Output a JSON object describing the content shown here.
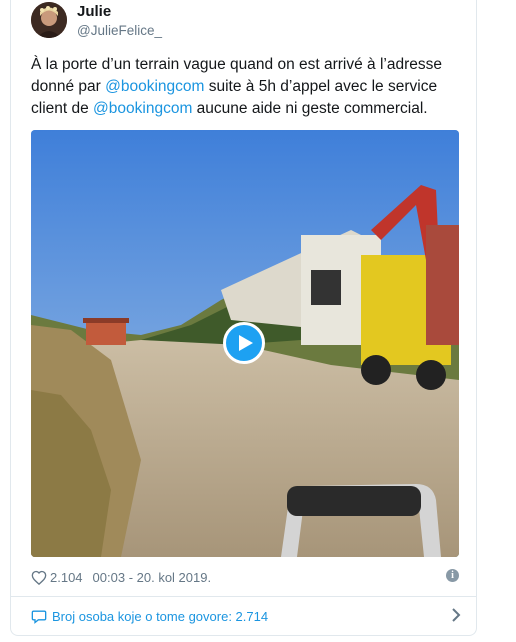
{
  "tweet": {
    "name": "Julie",
    "handle": "@JulieFelice_",
    "text_parts": {
      "p1": "À la porte d’un terrain vague quand on est arrivé à l’adresse donné par ",
      "m1": "@bookingcom",
      "p2": " suite à 5h d’appel avec le service client de ",
      "m2": "@bookingcom",
      "p3": " aucune aide ni geste commercial."
    },
    "likes": "2.104",
    "time": "00:03 - 20. kol 2019.",
    "footer_text": "Broj osoba koje o tome govore: 2.714"
  },
  "colors": {
    "accent": "#1da1f2",
    "link": "#1b95e0",
    "muted": "#657786",
    "border": "#e1e8ed"
  },
  "icons": {
    "heart": "heart-icon",
    "info": "info-icon",
    "play": "play-icon",
    "comment": "speech-bubble-icon",
    "chevron": "chevron-right-icon"
  }
}
